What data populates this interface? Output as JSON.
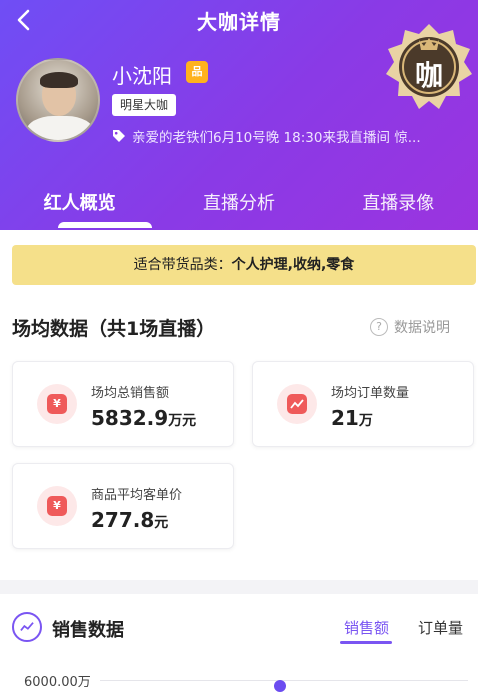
{
  "header": {
    "title": "大咖详情",
    "name": "小沈阳",
    "name_badge": "品",
    "tag": "明星大咖",
    "description": "亲爱的老铁们6月10号晚 18:30来我直播间 惊...",
    "medal_char": "咖"
  },
  "tabs": [
    {
      "label": "红人概览",
      "active": true
    },
    {
      "label": "直播分析",
      "active": false
    },
    {
      "label": "直播录像",
      "active": false
    }
  ],
  "notice": {
    "prefix": "适合带货品类：",
    "categories": "个人护理,收纳,零食"
  },
  "stats_section": {
    "title": "场均数据（共1场直播）",
    "help_label": "数据说明",
    "cards": [
      {
        "label": "场均总销售额",
        "value": "5832.9",
        "unit": "万元",
        "icon": "money-bag-icon"
      },
      {
        "label": "场均订单数量",
        "value": "21",
        "unit": "万",
        "icon": "chart-trend-icon"
      },
      {
        "label": "商品平均客单价",
        "value": "277.8",
        "unit": "元",
        "icon": "ticket-icon"
      }
    ]
  },
  "sales_section": {
    "title": "销售数据",
    "tabs": [
      {
        "label": "销售额",
        "active": true
      },
      {
        "label": "订单量",
        "active": false
      }
    ],
    "y_label": "6000.00万"
  },
  "colors": {
    "header_start": "#6f4ef5",
    "header_end": "#9b34df",
    "accent": "#7a55f2",
    "notice_bg": "#f5e08a",
    "icon_red": "#ef5a5a"
  }
}
